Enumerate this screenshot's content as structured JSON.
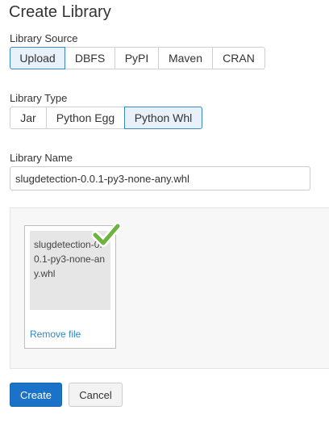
{
  "dialog": {
    "title": "Create Library"
  },
  "source": {
    "label": "Library Source",
    "options": [
      "Upload",
      "DBFS",
      "PyPI",
      "Maven",
      "CRAN"
    ],
    "selected": "Upload"
  },
  "type": {
    "label": "Library Type",
    "options": [
      "Jar",
      "Python Egg",
      "Python Whl"
    ],
    "selected": "Python Whl"
  },
  "name": {
    "label": "Library Name",
    "value": "slugdetection-0.0.1-py3-none-any.whl"
  },
  "upload": {
    "file_name": "slugdetection-0.0.1-py3-none-any.whl",
    "remove_label": "Remove file",
    "status_icon": "check-icon",
    "status_color": "#6cb33f"
  },
  "actions": {
    "create_label": "Create",
    "cancel_label": "Cancel",
    "primary_color": "#1a73c8"
  }
}
